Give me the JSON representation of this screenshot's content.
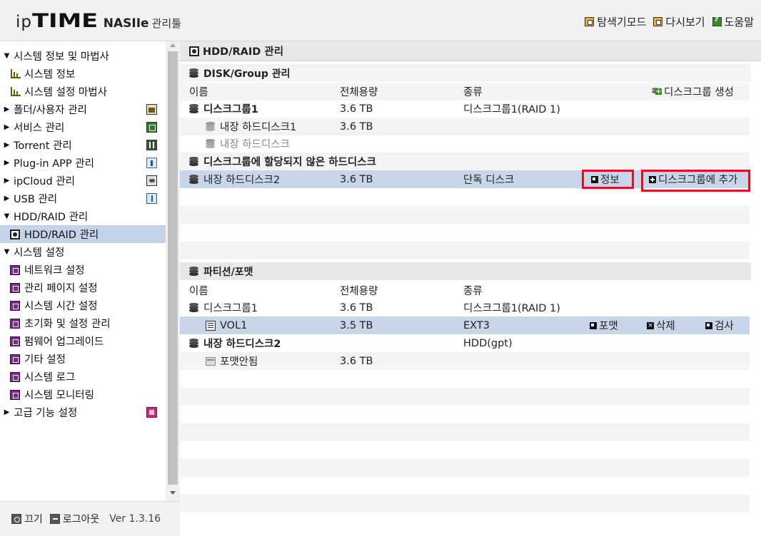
{
  "header": {
    "logo_ip": "ip",
    "logo_time": "TIME",
    "logo_nas": "NASIIe",
    "logo_tool": "관리툴",
    "links": [
      {
        "label": "탐색기모드",
        "icon": "explorer-icon"
      },
      {
        "label": "다시보기",
        "icon": "refresh-icon"
      },
      {
        "label": "도움말",
        "icon": "help-icon"
      }
    ]
  },
  "sidebar": {
    "items": [
      {
        "label": "시스템 정보 및 마법사",
        "type": "group",
        "expanded": true
      },
      {
        "label": "시스템 정보",
        "type": "sub",
        "icon": "chart-icon"
      },
      {
        "label": "시스템 설정 마법사",
        "type": "sub",
        "icon": "chart-icon"
      },
      {
        "label": "폴더/사용자 관리",
        "type": "group",
        "expanded": false,
        "icon": "folder-user-icon"
      },
      {
        "label": "서비스 관리",
        "type": "group",
        "expanded": false,
        "icon": "service-icon"
      },
      {
        "label": "Torrent 관리",
        "type": "group",
        "expanded": false,
        "icon": "torrent-icon"
      },
      {
        "label": "Plug-in APP 관리",
        "type": "group",
        "expanded": false,
        "icon": "plugin-icon"
      },
      {
        "label": "ipCloud 관리",
        "type": "group",
        "expanded": false,
        "icon": "cloud-icon"
      },
      {
        "label": "USB 관리",
        "type": "group",
        "expanded": false,
        "icon": "usb-icon"
      },
      {
        "label": "HDD/RAID 관리",
        "type": "group",
        "expanded": true
      },
      {
        "label": "HDD/RAID 관리",
        "type": "sub",
        "icon": "hdd-icon",
        "selected": true
      },
      {
        "label": "시스템 설정",
        "type": "group",
        "expanded": true
      },
      {
        "label": "네트워크 설정",
        "type": "sub",
        "icon": "settings-icon"
      },
      {
        "label": "관리 페이지 설정",
        "type": "sub",
        "icon": "settings-icon"
      },
      {
        "label": "시스템 시간 설정",
        "type": "sub",
        "icon": "settings-icon"
      },
      {
        "label": "초기화 및 설정 관리",
        "type": "sub",
        "icon": "settings-icon"
      },
      {
        "label": "펌웨어 업그레이드",
        "type": "sub",
        "icon": "settings-icon"
      },
      {
        "label": "기타 설정",
        "type": "sub",
        "icon": "settings-icon"
      },
      {
        "label": "시스템 로그",
        "type": "sub",
        "icon": "settings-icon"
      },
      {
        "label": "시스템 모니터링",
        "type": "sub",
        "icon": "settings-icon"
      },
      {
        "label": "고급 기능 설정",
        "type": "group",
        "expanded": false,
        "icon": "advanced-icon"
      }
    ],
    "footer": {
      "power_label": "끄기",
      "logout_label": "로그아웃",
      "version": "Ver 1.3.16"
    }
  },
  "main": {
    "title": "HDD/RAID 관리",
    "disk_section": {
      "title": "DISK/Group 관리",
      "columns": [
        "이름",
        "전체용량",
        "종류"
      ],
      "create_label": "디스크그룹 생성",
      "groups": [
        {
          "name": "디스크그룹1",
          "size": "3.6 TB",
          "type": "디스크그룹1(RAID 1)"
        },
        {
          "name": "내장 하드디스크1",
          "size": "3.6 TB",
          "type": ""
        },
        {
          "name": "내장 하드디스크",
          "size": "",
          "type": ""
        }
      ],
      "unassigned_title": "디스크그룹에 할당되지 않은 하드디스크",
      "unassigned": {
        "name": "내장 하드디스크2",
        "size": "3.6 TB",
        "type": "단독 디스크",
        "info_label": "정보",
        "add_label": "디스크그룹에 추가"
      }
    },
    "partition_section": {
      "title": "파티션/포맷",
      "columns": [
        "이름",
        "전체용량",
        "종류"
      ],
      "rows": [
        {
          "name": "디스크그룹1",
          "size": "3.6 TB",
          "type": "디스크그룹1(RAID 1)"
        },
        {
          "name": "VOL1",
          "size": "3.5 TB",
          "type": "EXT3",
          "format_label": "포맷",
          "delete_label": "삭제",
          "check_label": "검사"
        },
        {
          "name": "내장 하드디스크2",
          "size": "",
          "type": "HDD(gpt)"
        },
        {
          "name": "포맷안됨",
          "size": "3.6 TB",
          "type": ""
        }
      ]
    }
  },
  "colors": {
    "selected_row": "#c9d5e8",
    "highlight_box": "#e0121e",
    "header_bg": "#f1f1f1"
  }
}
